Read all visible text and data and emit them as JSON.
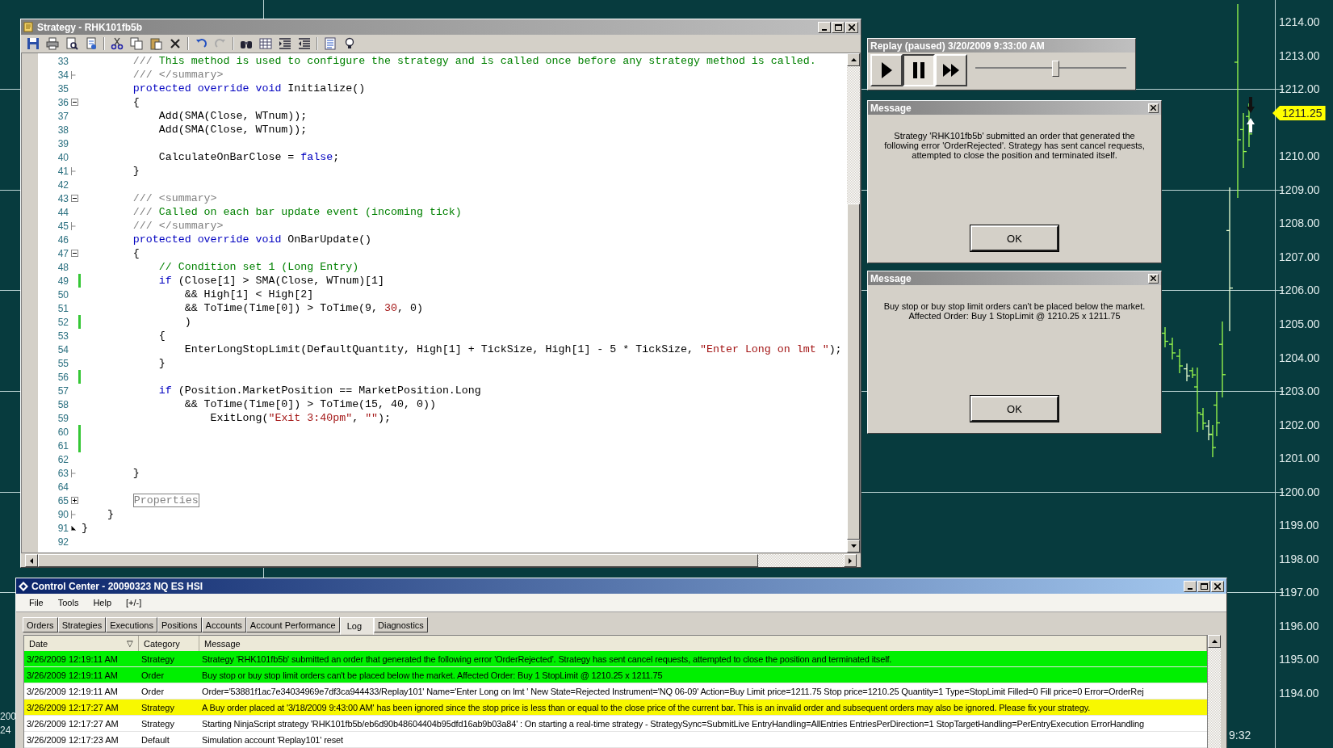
{
  "editor": {
    "title": "Strategy - RHK101fb5b",
    "lines": [
      {
        "number": "33",
        "kind": "plain",
        "changed": false,
        "segments": [
          {
            "kind": "doc",
            "text": "        /// "
          },
          {
            "kind": "comment",
            "text": "This method is used to configure the strategy and is called once before any strategy method is called."
          }
        ]
      },
      {
        "number": "34",
        "kind": "fold_end",
        "changed": false,
        "segments": [
          {
            "kind": "doc",
            "text": "        /// </summary>"
          }
        ]
      },
      {
        "number": "35",
        "kind": "plain",
        "changed": false,
        "segments": [
          {
            "kind": "keyword",
            "text": "        protected override void"
          },
          {
            "kind": "plain",
            "text": " Initialize()"
          }
        ]
      },
      {
        "number": "36",
        "kind": "fold_open",
        "changed": false,
        "segments": [
          {
            "kind": "plain",
            "text": "        {"
          }
        ]
      },
      {
        "number": "37",
        "kind": "plain",
        "changed": false,
        "segments": [
          {
            "kind": "plain",
            "text": "            Add(SMA(Close, WTnum));"
          }
        ]
      },
      {
        "number": "38",
        "kind": "plain",
        "changed": false,
        "segments": [
          {
            "kind": "plain",
            "text": "            Add(SMA(Close, WTnum));"
          }
        ]
      },
      {
        "number": "39",
        "kind": "plain",
        "changed": false
      },
      {
        "number": "40",
        "kind": "plain",
        "changed": false,
        "segments": [
          {
            "kind": "plain",
            "text": "            CalculateOnBarClose = "
          },
          {
            "kind": "keyword",
            "text": "false"
          },
          {
            "kind": "plain",
            "text": ";"
          }
        ]
      },
      {
        "number": "41",
        "kind": "fold_end",
        "changed": false,
        "segments": [
          {
            "kind": "plain",
            "text": "        }"
          }
        ]
      },
      {
        "number": "42",
        "kind": "plain",
        "changed": false
      },
      {
        "number": "43",
        "kind": "fold_open",
        "changed": false,
        "segments": [
          {
            "kind": "doc",
            "text": "        /// <summary>"
          }
        ]
      },
      {
        "number": "44",
        "kind": "plain",
        "changed": false,
        "segments": [
          {
            "kind": "doc",
            "text": "        /// "
          },
          {
            "kind": "comment",
            "text": "Called on each bar update event (incoming tick)"
          }
        ]
      },
      {
        "number": "45",
        "kind": "fold_end",
        "changed": false,
        "segments": [
          {
            "kind": "doc",
            "text": "        /// </summary>"
          }
        ]
      },
      {
        "number": "46",
        "kind": "plain",
        "changed": false,
        "segments": [
          {
            "kind": "keyword",
            "text": "        protected override void"
          },
          {
            "kind": "plain",
            "text": " OnBarUpdate()"
          }
        ]
      },
      {
        "number": "47",
        "kind": "fold_open",
        "changed": false,
        "segments": [
          {
            "kind": "plain",
            "text": "        {"
          }
        ]
      },
      {
        "number": "48",
        "kind": "plain",
        "changed": false,
        "segments": [
          {
            "kind": "comment",
            "text": "            // Condition set 1 (Long Entry)"
          }
        ]
      },
      {
        "number": "49",
        "kind": "plain",
        "changed": true,
        "segments": [
          {
            "kind": "keyword",
            "text": "            if"
          },
          {
            "kind": "plain",
            "text": " (Close[1] > SMA(Close, WTnum)[1]"
          }
        ]
      },
      {
        "number": "50",
        "kind": "plain",
        "changed": false,
        "segments": [
          {
            "kind": "plain",
            "text": "                && High[1] < High[2]"
          }
        ]
      },
      {
        "number": "51",
        "kind": "plain",
        "changed": false,
        "segments": [
          {
            "kind": "plain",
            "text": "                && ToTime(Time[0]) > ToTime(9, "
          },
          {
            "kind": "number",
            "text": "30"
          },
          {
            "kind": "plain",
            "text": ", 0)"
          }
        ]
      },
      {
        "number": "52",
        "kind": "plain",
        "changed": true,
        "segments": [
          {
            "kind": "plain",
            "text": "                )"
          }
        ]
      },
      {
        "number": "53",
        "kind": "plain",
        "changed": false,
        "segments": [
          {
            "kind": "plain",
            "text": "            {"
          }
        ]
      },
      {
        "number": "54",
        "kind": "plain",
        "changed": false,
        "segments": [
          {
            "kind": "plain",
            "text": "                EnterLongStopLimit(DefaultQuantity, High[1] + TickSize, High[1] - 5 * TickSize, "
          },
          {
            "kind": "string",
            "text": "\"Enter Long on lmt \""
          },
          {
            "kind": "plain",
            "text": ");"
          }
        ]
      },
      {
        "number": "55",
        "kind": "plain",
        "changed": false,
        "segments": [
          {
            "kind": "plain",
            "text": "            }"
          }
        ]
      },
      {
        "number": "56",
        "kind": "plain",
        "changed": true
      },
      {
        "number": "57",
        "kind": "plain",
        "changed": false,
        "segments": [
          {
            "kind": "keyword",
            "text": "            if"
          },
          {
            "kind": "plain",
            "text": " (Position.MarketPosition == MarketPosition.Long"
          }
        ]
      },
      {
        "number": "58",
        "kind": "plain",
        "changed": false,
        "segments": [
          {
            "kind": "plain",
            "text": "                && ToTime(Time[0]) > ToTime(15, 40, 0))"
          }
        ]
      },
      {
        "number": "59",
        "kind": "plain",
        "changed": false,
        "segments": [
          {
            "kind": "plain",
            "text": "                    ExitLong("
          },
          {
            "kind": "string",
            "text": "\"Exit 3:40pm\""
          },
          {
            "kind": "plain",
            "text": ", "
          },
          {
            "kind": "string",
            "text": "\"\""
          },
          {
            "kind": "plain",
            "text": ");"
          }
        ]
      },
      {
        "number": "60",
        "kind": "plain",
        "changed": true
      },
      {
        "number": "61",
        "kind": "plain",
        "changed": true
      },
      {
        "number": "62",
        "kind": "plain",
        "changed": false
      },
      {
        "number": "63",
        "kind": "fold_end",
        "changed": false,
        "segments": [
          {
            "kind": "plain",
            "text": "        }"
          }
        ]
      },
      {
        "number": "64",
        "kind": "plain",
        "changed": false
      },
      {
        "number": "65",
        "kind": "fold_closed",
        "changed": false,
        "segments": [
          {
            "kind": "region",
            "text": "        Properties"
          }
        ]
      },
      {
        "number": "90",
        "kind": "fold_end",
        "changed": false,
        "segments": [
          {
            "kind": "plain",
            "text": "    }"
          }
        ]
      },
      {
        "number": "91",
        "kind": "fold_last",
        "changed": false,
        "segments": [
          {
            "kind": "plain",
            "text": "}"
          }
        ]
      },
      {
        "number": "92",
        "kind": "plain",
        "changed": false
      }
    ]
  },
  "replay": {
    "title": "Replay (paused) 3/20/2009 9:33:00 AM",
    "buttons": [
      {
        "kind": "play",
        "selected": false
      },
      {
        "kind": "pause",
        "selected": true
      },
      {
        "kind": "fast_forward",
        "selected": false
      }
    ],
    "slider": {
      "level": 0.53
    }
  },
  "messages": [
    {
      "title": "Message",
      "text": "Strategy 'RHK101fb5b' submitted an order that generated the following error 'OrderRejected'. Strategy has sent cancel requests, attempted to close the position and terminated itself.",
      "button": "OK"
    },
    {
      "title": "Message",
      "text": "Buy stop or buy stop limit orders can't be placed below the market. Affected Order: Buy 1 StopLimit @ 1210.25 x 1211.75",
      "button": "OK"
    }
  ],
  "chart": {
    "price_labels_upper": [
      "1214.00",
      "1213.00",
      "1212.00"
    ],
    "price_labels_lower": [
      "1210.00",
      "1209.00",
      "1208.00",
      "1207.00",
      "1206.00",
      "1205.00",
      "1204.00",
      "1203.00",
      "1202.00",
      "1201.00",
      "1200.00",
      "1199.00",
      "1198.00",
      "1197.00",
      "1196.00",
      "1195.00",
      "1194.00"
    ],
    "current_price": "1211.25",
    "time_label": "9:32",
    "edge_labels": [
      "200",
      "24"
    ]
  },
  "control_center": {
    "title": "Control Center - 20090323 NQ ES HSI",
    "menu": [
      "File",
      "Tools",
      "Help",
      "[+/-]"
    ],
    "tabs": [
      {
        "label": "Orders",
        "selected": false
      },
      {
        "label": "Strategies",
        "selected": false
      },
      {
        "label": "Executions",
        "selected": false
      },
      {
        "label": "Positions",
        "selected": false
      },
      {
        "label": "Accounts",
        "selected": false
      },
      {
        "label": "Account Performance",
        "selected": false
      },
      {
        "label": "Log",
        "selected": true
      },
      {
        "label": "Diagnostics",
        "selected": false
      }
    ],
    "columns": [
      {
        "label": "Date",
        "sort_mark": "▽"
      },
      {
        "label": "Category"
      },
      {
        "label": "Message"
      }
    ],
    "rows": [
      {
        "date": "3/26/2009 12:19:11 AM",
        "category": "Strategy",
        "message": "Strategy 'RHK101fb5b' submitted an order that generated the following error 'OrderRejected'. Strategy has sent cancel requests, attempted to close the position and terminated itself.",
        "color": "#00f000"
      },
      {
        "date": "3/26/2009 12:19:11 AM",
        "category": "Order",
        "message": "Buy stop or buy stop limit orders can't be placed below the market. Affected Order: Buy 1 StopLimit @ 1210.25 x 1211.75",
        "color": "#00f000"
      },
      {
        "date": "3/26/2009 12:19:11 AM",
        "category": "Order",
        "message": "Order='53881f1ac7e34034969e7df3ca944433/Replay101' Name='Enter Long on lmt ' New State=Rejected Instrument='NQ 06-09' Action=Buy Limit price=1211.75 Stop price=1210.25 Quantity=1 Type=StopLimit Filled=0 Fill price=0 Error=OrderRej",
        "color": "#ffffff"
      },
      {
        "date": "3/26/2009 12:17:27 AM",
        "category": "Strategy",
        "message": "A Buy order placed at '3/18/2009 9:43:00 AM' has been ignored since the stop price is less than or equal to the close price of the current bar. This is an invalid order and subsequent orders may also be ignored. Please fix your strategy.",
        "color": "#f8f800"
      },
      {
        "date": "3/26/2009 12:17:27 AM",
        "category": "Strategy",
        "message": "Starting NinjaScript strategy 'RHK101fb5b/eb6d90b48604404b95dfd16ab9b03a84' : On starting a real-time strategy - StrategySync=SubmitLive EntryHandling=AllEntries EntriesPerDirection=1 StopTargetHandling=PerEntryExecution ErrorHandling",
        "color": "#ffffff"
      },
      {
        "date": "3/26/2009 12:17:23 AM",
        "category": "Default",
        "message": "Simulation account 'Replay101' reset",
        "color": "#ffffff"
      }
    ]
  }
}
